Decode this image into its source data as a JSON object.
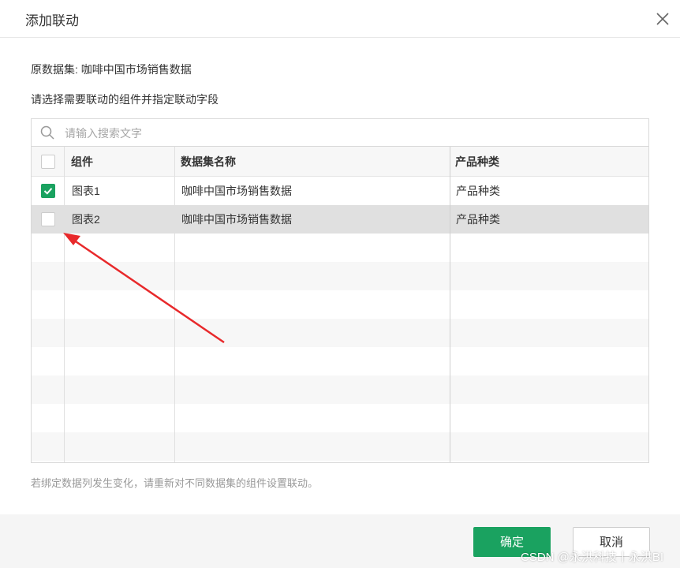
{
  "dialog": {
    "title": "添加联动",
    "close_icon": "close-icon"
  },
  "source_line": "原数据集: 咖啡中国市场销售数据",
  "instruction": "请选择需要联动的组件并指定联动字段",
  "search": {
    "placeholder": "请输入搜索文字",
    "value": "",
    "icon": "search-icon"
  },
  "table": {
    "columns": [
      "组件",
      "数据集名称",
      "产品种类"
    ],
    "rows": [
      {
        "checked": true,
        "component": "图表1",
        "dataset": "咖啡中国市场销售数据",
        "field": "产品种类"
      },
      {
        "checked": false,
        "component": "图表2",
        "dataset": "咖啡中国市场销售数据",
        "field": "产品种类"
      }
    ]
  },
  "hint": "若绑定数据列发生变化，请重新对不同数据集的组件设置联动。",
  "footer": {
    "ok_label": "确定",
    "cancel_label": "取消"
  },
  "watermark": "CSDN @永洪科技丨永洪BI",
  "colors": {
    "accent": "#1aa260",
    "selected_row": "#e0e0e0",
    "annotation_arrow": "#e8292b"
  }
}
